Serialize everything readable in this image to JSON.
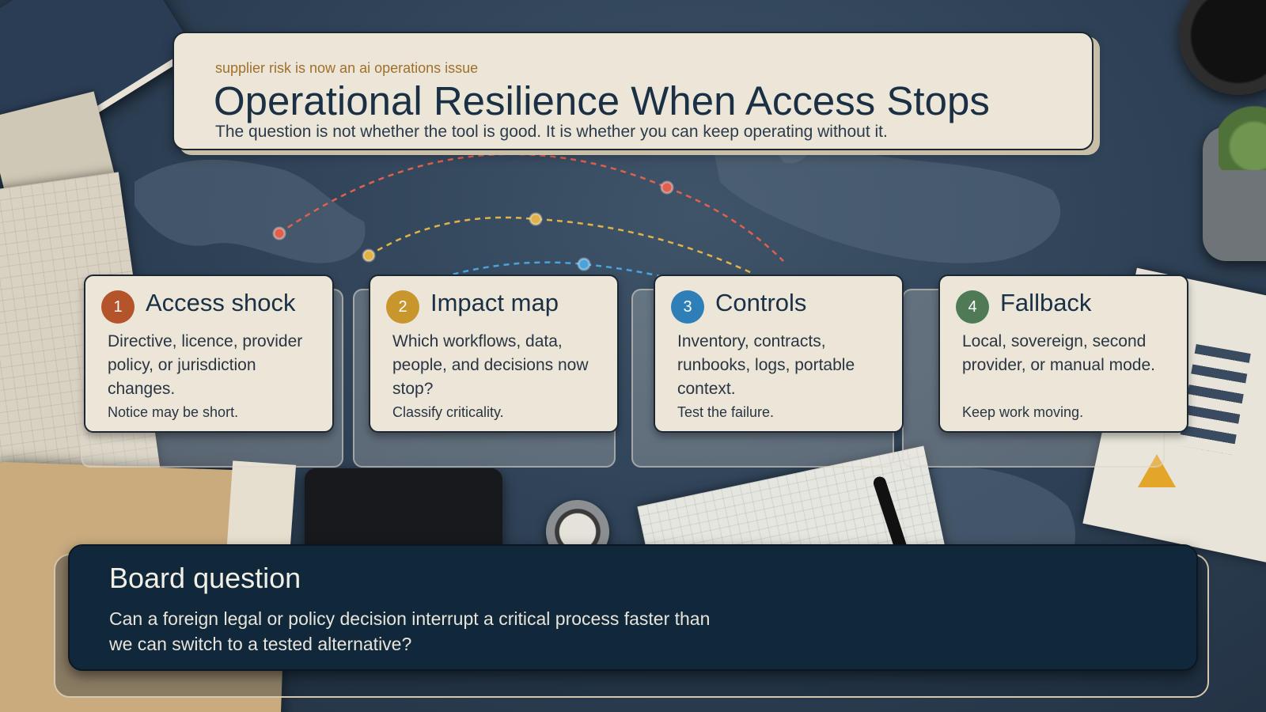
{
  "header": {
    "kicker": "supplier risk is now an ai operations issue",
    "title": "Operational Resilience When Access Stops",
    "subtitle": "The question is not whether the tool is good. It is whether you can keep operating without it."
  },
  "steps": [
    {
      "number": "1",
      "title": "Access shock",
      "body": "Directive, licence, provider policy, or jurisdiction changes.",
      "note": "Notice may be short.",
      "color": "#b5532a"
    },
    {
      "number": "2",
      "title": "Impact map",
      "body": "Which workflows, data, people, and decisions now stop?",
      "note": "Classify criticality.",
      "color": "#c8962c"
    },
    {
      "number": "3",
      "title": "Controls",
      "body": "Inventory, contracts, runbooks, logs, portable context.",
      "note": "Test the failure.",
      "color": "#2e7fb8"
    },
    {
      "number": "4",
      "title": "Fallback",
      "body": "Local, sovereign, second provider, or manual mode.",
      "note": "Keep work moving.",
      "color": "#4f7a55"
    }
  ],
  "board": {
    "title": "Board question",
    "text": "Can a foreign legal or policy decision interrupt a critical process faster than we can switch to a tested alternative?"
  },
  "route_colors": {
    "red": "#e0604e",
    "yellow": "#e2b24a",
    "blue": "#4aa3dc"
  }
}
